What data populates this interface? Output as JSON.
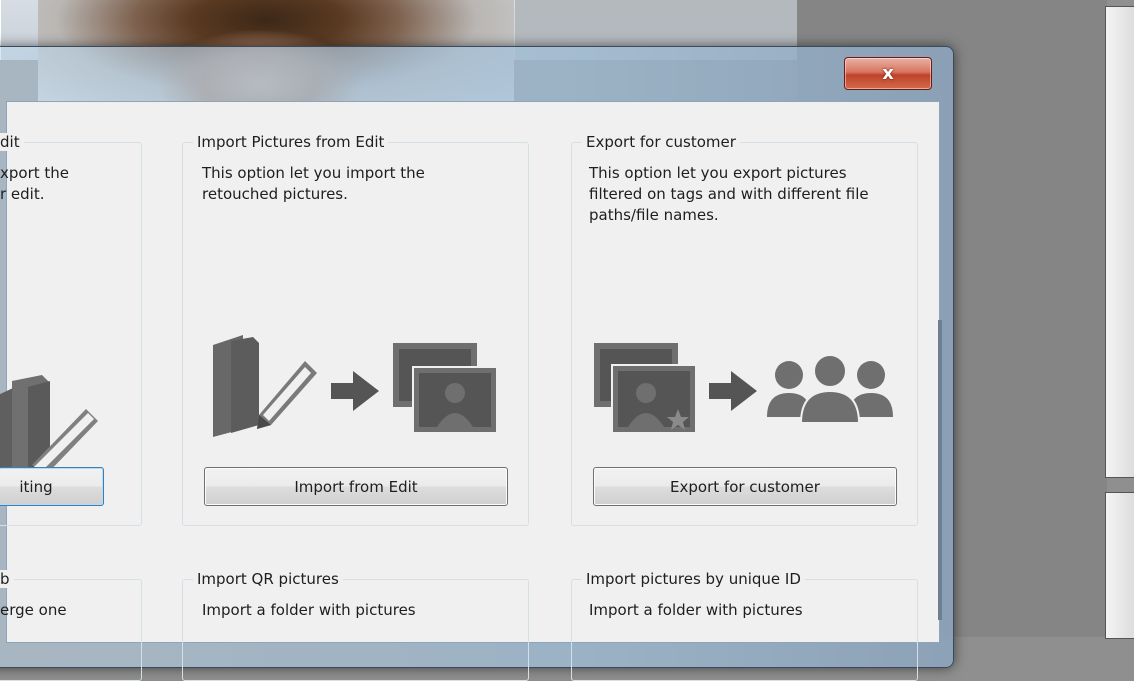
{
  "dialog": {
    "close_label": "x"
  },
  "groups": {
    "left_top": {
      "title": "dit",
      "description": "xport the\nr edit.",
      "button": "iting"
    },
    "import_edit": {
      "title": "Import Pictures from Edit",
      "description": "This option let you import the retouched pictures.",
      "button": "Import from Edit"
    },
    "export_customer": {
      "title": "Export for customer",
      "description": "This option let you export pictures filtered on tags and with different file paths/file names.",
      "button": "Export for customer"
    },
    "left_bottom": {
      "title": "b",
      "description": "erge one"
    },
    "import_qr": {
      "title": "Import QR pictures",
      "description": "Import a folder with pictures"
    },
    "import_id": {
      "title": "Import pictures by unique ID",
      "description": "Import a folder with pictures"
    }
  },
  "icons": {
    "folder_edit": "folder-edit-icon",
    "arrow": "arrow-right-icon",
    "pictures": "pictures-icon",
    "customers": "group-people-icon"
  },
  "colors": {
    "icon_gray": "#666666",
    "dialog_bg": "#f0f0f0",
    "close_red": "#c0422a"
  }
}
